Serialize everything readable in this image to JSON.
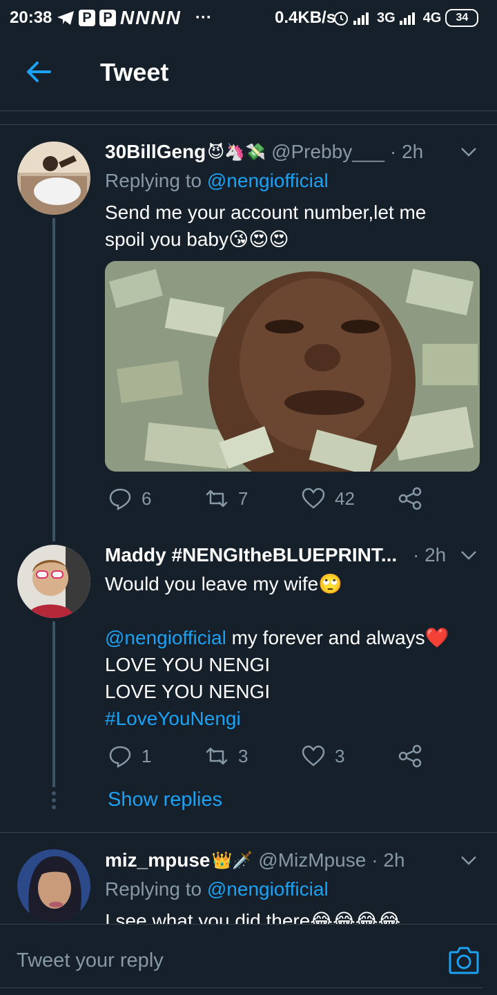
{
  "status_bar": {
    "time": "20:38",
    "app_icons": [
      "P",
      "P"
    ],
    "n_icons": "NNNN",
    "more": "···",
    "net_speed": "0.4KB/s",
    "net1": "3G",
    "net2": "4G",
    "battery": "34"
  },
  "header": {
    "title": "Tweet",
    "back_icon": "arrow-left-icon"
  },
  "tweets": [
    {
      "name": "30BillGeng",
      "name_emoji": "😈🦄💸",
      "handle": "@Prebby___",
      "time": "· 2h",
      "replying_prefix": "Replying to ",
      "replying_to": "@nengiofficial",
      "text_lines": [
        "Send me your account number,let me",
        "spoil you baby😘😍😍"
      ],
      "replies": "6",
      "retweets": "7",
      "likes": "42"
    },
    {
      "name": "Maddy #NENGItheBLUEPRINT...",
      "handle": "",
      "time": "· 2h",
      "text_line1": "Would you leave my wife🙄",
      "mention": "@nengiofficial",
      "text_line2_rest": " my forever and always❤️",
      "text_line3": "LOVE YOU NENGI",
      "text_line4": "LOVE YOU NENGI",
      "hashtag": "#LoveYouNengi",
      "replies": "1",
      "retweets": "3",
      "likes": "3",
      "show_replies": "Show replies"
    },
    {
      "name": "miz_mpuse",
      "name_emoji": "👑🗡️",
      "handle": "@MizMpuse",
      "time": "· 2h",
      "replying_prefix": "Replying to ",
      "replying_to": "@nengiofficial",
      "text_partial": "I see what you did there😂😂😂😂"
    }
  ],
  "reply_bar": {
    "placeholder": "Tweet your reply",
    "camera_icon": "camera-icon"
  },
  "colors": {
    "background": "#15202b",
    "accent": "#1da1f2",
    "muted": "#8899a6",
    "divider": "#38444d"
  }
}
